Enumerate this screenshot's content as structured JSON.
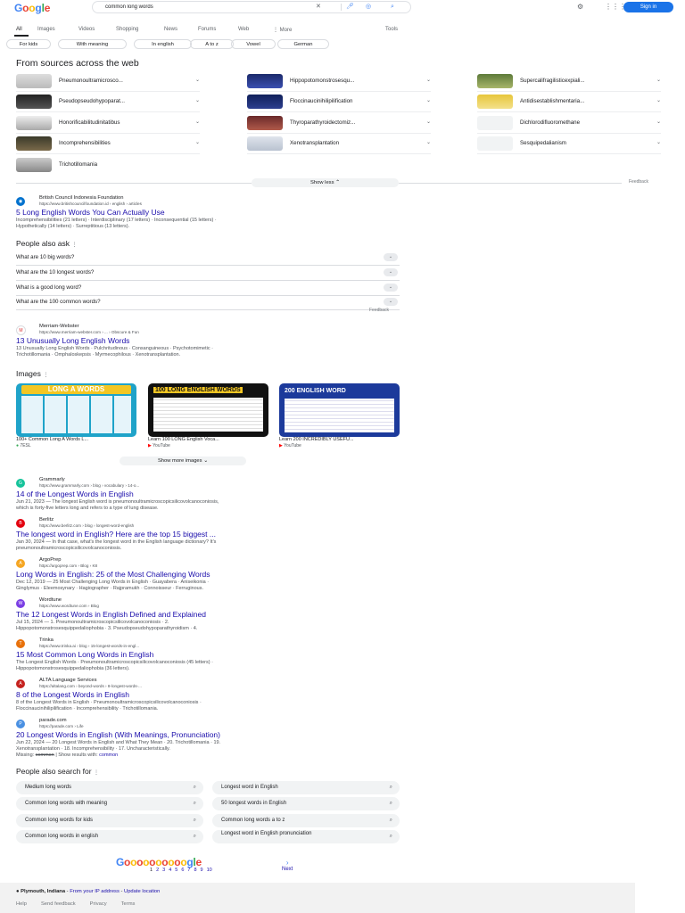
{
  "logo": [
    "G",
    "o",
    "o",
    "g",
    "l",
    "e"
  ],
  "search": {
    "query": "common long words"
  },
  "header": {
    "signin": "Sign in"
  },
  "tabs": [
    "All",
    "Images",
    "Videos",
    "Shopping",
    "News",
    "Forums",
    "Web",
    "⋮ More"
  ],
  "tools": "Tools",
  "chips": [
    "For kids",
    "With meaning",
    "In english",
    "A to z",
    "Vowel",
    "German"
  ],
  "sources_heading": "From sources across the web",
  "entities": [
    "Pneumonoultramicrosco...",
    "Hippopotomonstrosesqu...",
    "Supercalifragilisticexpiali...",
    "Pseudopseudohypoparat...",
    "Floccinaucinihilipilification",
    "Antidisestablishmentaria...",
    "Honorificabilitudinitatibus",
    "Thyroparathyroidectomiz...",
    "Dichlorodifluoromethane",
    "Incomprehensibilities",
    "Xenotransplantation",
    "Sesquipedalianism",
    "Trichotillomania"
  ],
  "show_less": "Show less",
  "feedback": "Feedback",
  "result1": {
    "site": "British Council Indonesia Foundation",
    "url": "https://www.britishcouncilfoundation.id › english › articles",
    "title": "5 Long English Words You Can Actually Use",
    "snippet_l1": "Incomprehensibilities (21 letters) · Interdisciplinary (17 letters) · Inconsequential (15 letters) ·",
    "snippet_l2": "Hypothetically (14 letters) · Surreptitious (13 letters)."
  },
  "paa": {
    "heading": "People also ask",
    "questions": [
      "What are 10 big words?",
      "What are the 10 longest words?",
      "What is a good long word?",
      "What are the 100 common words?"
    ]
  },
  "result2": {
    "site": "Merriam-Webster",
    "url": "https://www.merriam-webster.com › ... › Obscure & Fun",
    "title": "13 Unusually Long English Words",
    "snippet_l1": "13 Unusually Long English Words · Pulchritudinous · Consanguineous · Psychotomimetic ·",
    "snippet_l2": "Trichotillomania · Omphaloskepsis · Myrmecophilous · Xenotransplantation."
  },
  "images": {
    "heading": "Images",
    "cards": [
      {
        "title": "100+ Common Long A Words L...",
        "source": "7ESL",
        "banner": "LONG A WORDS"
      },
      {
        "title": "Learn 100 LONG English Voca...",
        "source": "YouTube",
        "banner": "100 LONG ENGLISH WORDS"
      },
      {
        "title": "Learn 200 INCREDIBLY USEFU...",
        "source": "YouTube",
        "banner": "200 ENGLISH WORD"
      }
    ],
    "show_more": "Show more images"
  },
  "results": [
    {
      "site": "Grammarly",
      "url": "https://www.grammarly.com › blog › vocabulary › 14-o...",
      "title": "14 of the Longest Words in English",
      "l1": "Jun 21, 2023 — The longest English word is pneumonoultramicroscopicsilicovolcanoconiosis,",
      "l2": "which is forty-five letters long and refers to a type of lung disease.",
      "color": "#15c39a",
      "ch": "G"
    },
    {
      "site": "Berlitz",
      "url": "https://www.berlitz.com › blog › longest-word-english",
      "title": "The longest word in English? Here are the top 15 biggest ...",
      "l1": "Jan 30, 2024 — In that case, what's the longest word in the English language dictionary? It's",
      "l2": "pneumonoultramicroscopicsilicovolcanoconiosis.",
      "color": "#e3000f",
      "ch": "B"
    },
    {
      "site": "ArgoPrep",
      "url": "https://argoprep.com › Blog › K8",
      "title": "Long Words in English: 25 of the Most Challenging Words",
      "l1": "Dec 12, 2019 — 25 Most Challenging Long Words in English · Guayabera · Aniseikonia ·",
      "l2": "Ginglymus · Eleemosynary · Hagiographer · Rajpramukh · Connoisseur · Ferruginous.",
      "color": "#f5a623",
      "ch": "A"
    },
    {
      "site": "Wordtune",
      "url": "https://www.wordtune.com › Blog",
      "title": "The 12 Longest Words in English Defined and Explained",
      "l1": "Jul 15, 2024 — 1. Pneumonoultramicroscopicsilicovolcanoconiosis · 2.",
      "l2": "Hippopotomonstrosesquippedaliophobia · 3. Pseudopseudohypoparathyroidism · 4.",
      "color": "#7b3fe4",
      "ch": "W"
    },
    {
      "site": "Trinka",
      "url": "https://www.trinka.ai › blog › 15-longest-words-in-engl...",
      "title": "15 Most Common Long Words in English",
      "l1": "The Longest English Words · Pneumonoultramicroscopicsilicovolcanoconiosis (45 letters) ·",
      "l2": "Hippopotomonstrosesquippedaliophobia (36 letters).",
      "color": "#e8710a",
      "ch": "T"
    },
    {
      "site": "ALTA Language Services",
      "url": "https://altalang.com › beyond-words › 8-longest-words-...",
      "title": "8 of the Longest Words in English",
      "l1": "8 of the Longest Words in English · Pneumonoultramicroscopicsilicovolcanoconiosis ·",
      "l2": "Floccinaucinihilipilification · Incomprehensibility · Trichotillomania.",
      "color": "#c5221f",
      "ch": "A"
    },
    {
      "site": "parade.com",
      "url": "https://parade.com › Life",
      "title": "20 Longest Words in English (With Meanings, Pronunciation)",
      "l1": "Jun 22, 2024 — 20 Longest Words in English and What They Mean · 20. Trichotillomania · 19.",
      "l2": "Xenotransplantation · 18. Incomprehensibility · 17. Uncharacteristically.",
      "color": "#4a90e2",
      "ch": "P"
    }
  ],
  "missing": {
    "prefix": "Missing: ",
    "struck": "common",
    "mid": " | Show results with: ",
    "link": "common"
  },
  "pas": {
    "heading": "People also search for",
    "items": [
      "Medium long words",
      "Longest word in English",
      "Common long words with meaning",
      "50 longest words in English",
      "Common long words for kids",
      "Common long words a to z",
      "Common long words in english",
      "Longest word in English pronunciation"
    ]
  },
  "pagination": {
    "logo": "Goooooooooogle",
    "pages": [
      "1",
      "2",
      "3",
      "4",
      "5",
      "6",
      "7",
      "8",
      "9",
      "10"
    ],
    "next": "Next"
  },
  "footer": {
    "location": "Plymouth, Indiana",
    "from_ip": "From your IP address",
    "update": "Update location",
    "links": [
      "Help",
      "Send feedback",
      "Privacy",
      "Terms"
    ]
  }
}
